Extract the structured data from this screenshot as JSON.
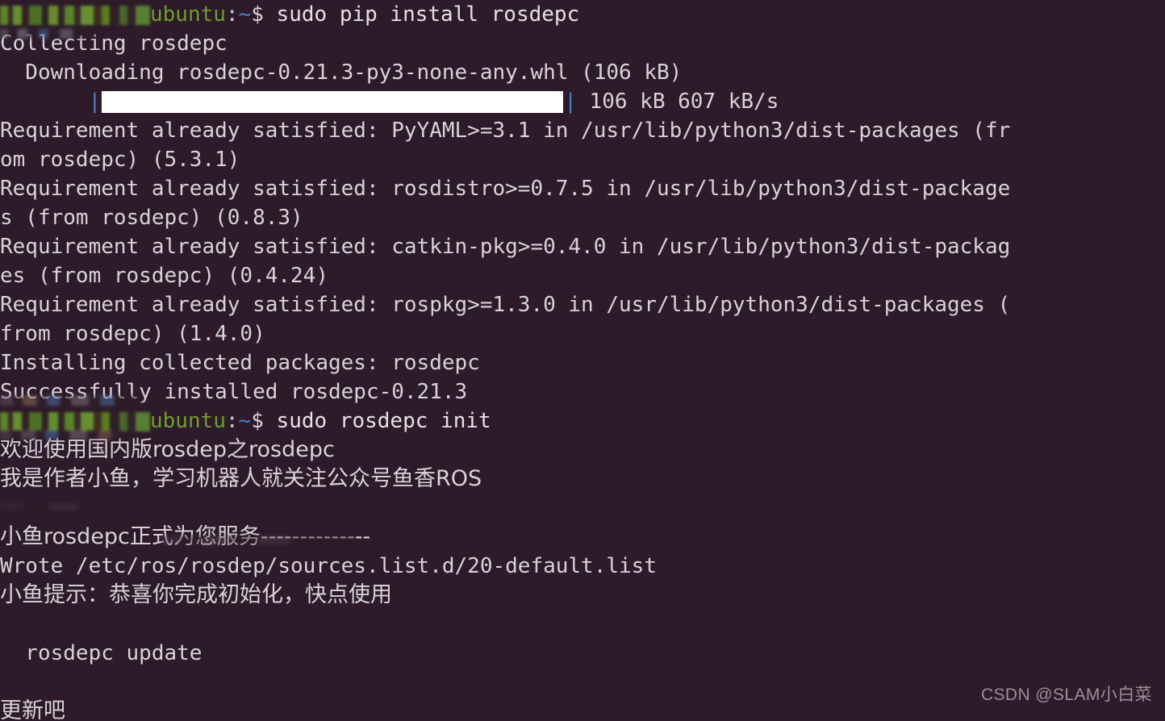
{
  "terminal": {
    "background_color": "#2d1b29",
    "foreground_color": "#d8d3d7",
    "prompt_user_color": "#6f9b2f",
    "prompt_path_color": "#4a7ec4",
    "shell_symbol": "$",
    "host": "ubuntu",
    "path": "~",
    "colon": ":",
    "commands": {
      "first": "sudo pip install rosdepc",
      "second": "sudo rosdepc init"
    },
    "lines": {
      "collecting": "Collecting rosdepc",
      "downloading": "  Downloading rosdepc-0.21.3-py3-none-any.whl (106 kB)",
      "progress_left_pipe": "|",
      "progress_right_pipe": "|",
      "progress_stats": "106 kB 607 kB/s",
      "req_pyyaml_1": "Requirement already satisfied: PyYAML>=3.1 in /usr/lib/python3/dist-packages (fr",
      "req_pyyaml_2": "om rosdepc) (5.3.1)",
      "req_rosdistro_1": "Requirement already satisfied: rosdistro>=0.7.5 in /usr/lib/python3/dist-package",
      "req_rosdistro_2": "s (from rosdepc) (0.8.3)",
      "req_catkin_1": "Requirement already satisfied: catkin-pkg>=0.4.0 in /usr/lib/python3/dist-packag",
      "req_catkin_2": "es (from rosdepc) (0.4.24)",
      "req_rospkg_1": "Requirement already satisfied: rospkg>=1.3.0 in /usr/lib/python3/dist-packages (",
      "req_rospkg_2": "from rosdepc) (1.4.0)",
      "installing": "Installing collected packages: rosdepc",
      "successfully": "Successfully installed rosdepc-0.21.3",
      "welcome_cn": "欢迎使用国内版rosdep之rosdepc",
      "author_cn": "我是作者小鱼，学习机器人就关注公众号鱼香ROS",
      "service_cn": "小鱼rosdepc正式为您服务--------------",
      "wrote": "Wrote /etc/ros/rosdep/sources.list.d/20-default.list",
      "tip_cn": "小鱼提示：恭喜你完成初始化，快点使用",
      "next_cmd": "  rosdepc update",
      "update_cn": "更新吧"
    }
  },
  "watermark": {
    "text": "CSDN @SLAM小白菜"
  }
}
